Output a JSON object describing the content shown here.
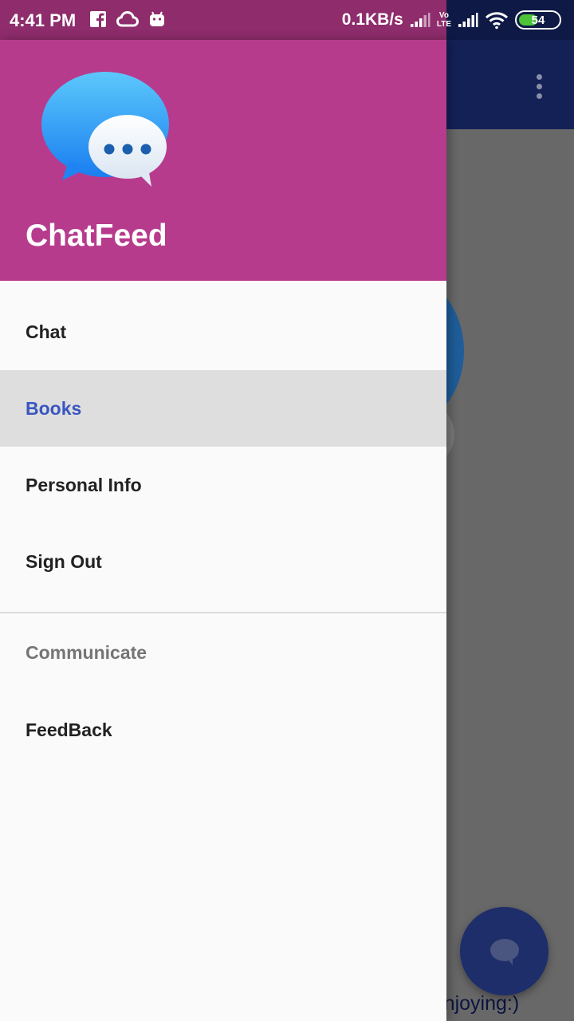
{
  "status_bar": {
    "time": "4:41 PM",
    "left_icons": [
      "facebook-icon",
      "cloud-icon",
      "android-icon"
    ],
    "network_speed": "0.1KB/s",
    "volte_top": "Vo",
    "volte_bottom": "LTE",
    "battery_level": "54",
    "battery_fraction": 0.54,
    "battery_color": "#4cc339"
  },
  "background_app": {
    "toolbar_color": "#142157",
    "visible_text_fragment": "!",
    "footer_text_fragment": "Enjoying:)",
    "fab_icon": "chat-bubble-icon"
  },
  "drawer": {
    "header_color": "#b73b8d",
    "app_name": "ChatFeed",
    "logo_icon": "chat-bubbles-logo-icon",
    "menu_items": [
      {
        "label": "Chat",
        "selected": false
      },
      {
        "label": "Books",
        "selected": true
      },
      {
        "label": "Personal Info",
        "selected": false
      },
      {
        "label": "Sign Out",
        "selected": false
      }
    ],
    "section_title": "Communicate",
    "section_items": [
      {
        "label": "FeedBack"
      }
    ],
    "selected_color": "#3a56c0"
  }
}
